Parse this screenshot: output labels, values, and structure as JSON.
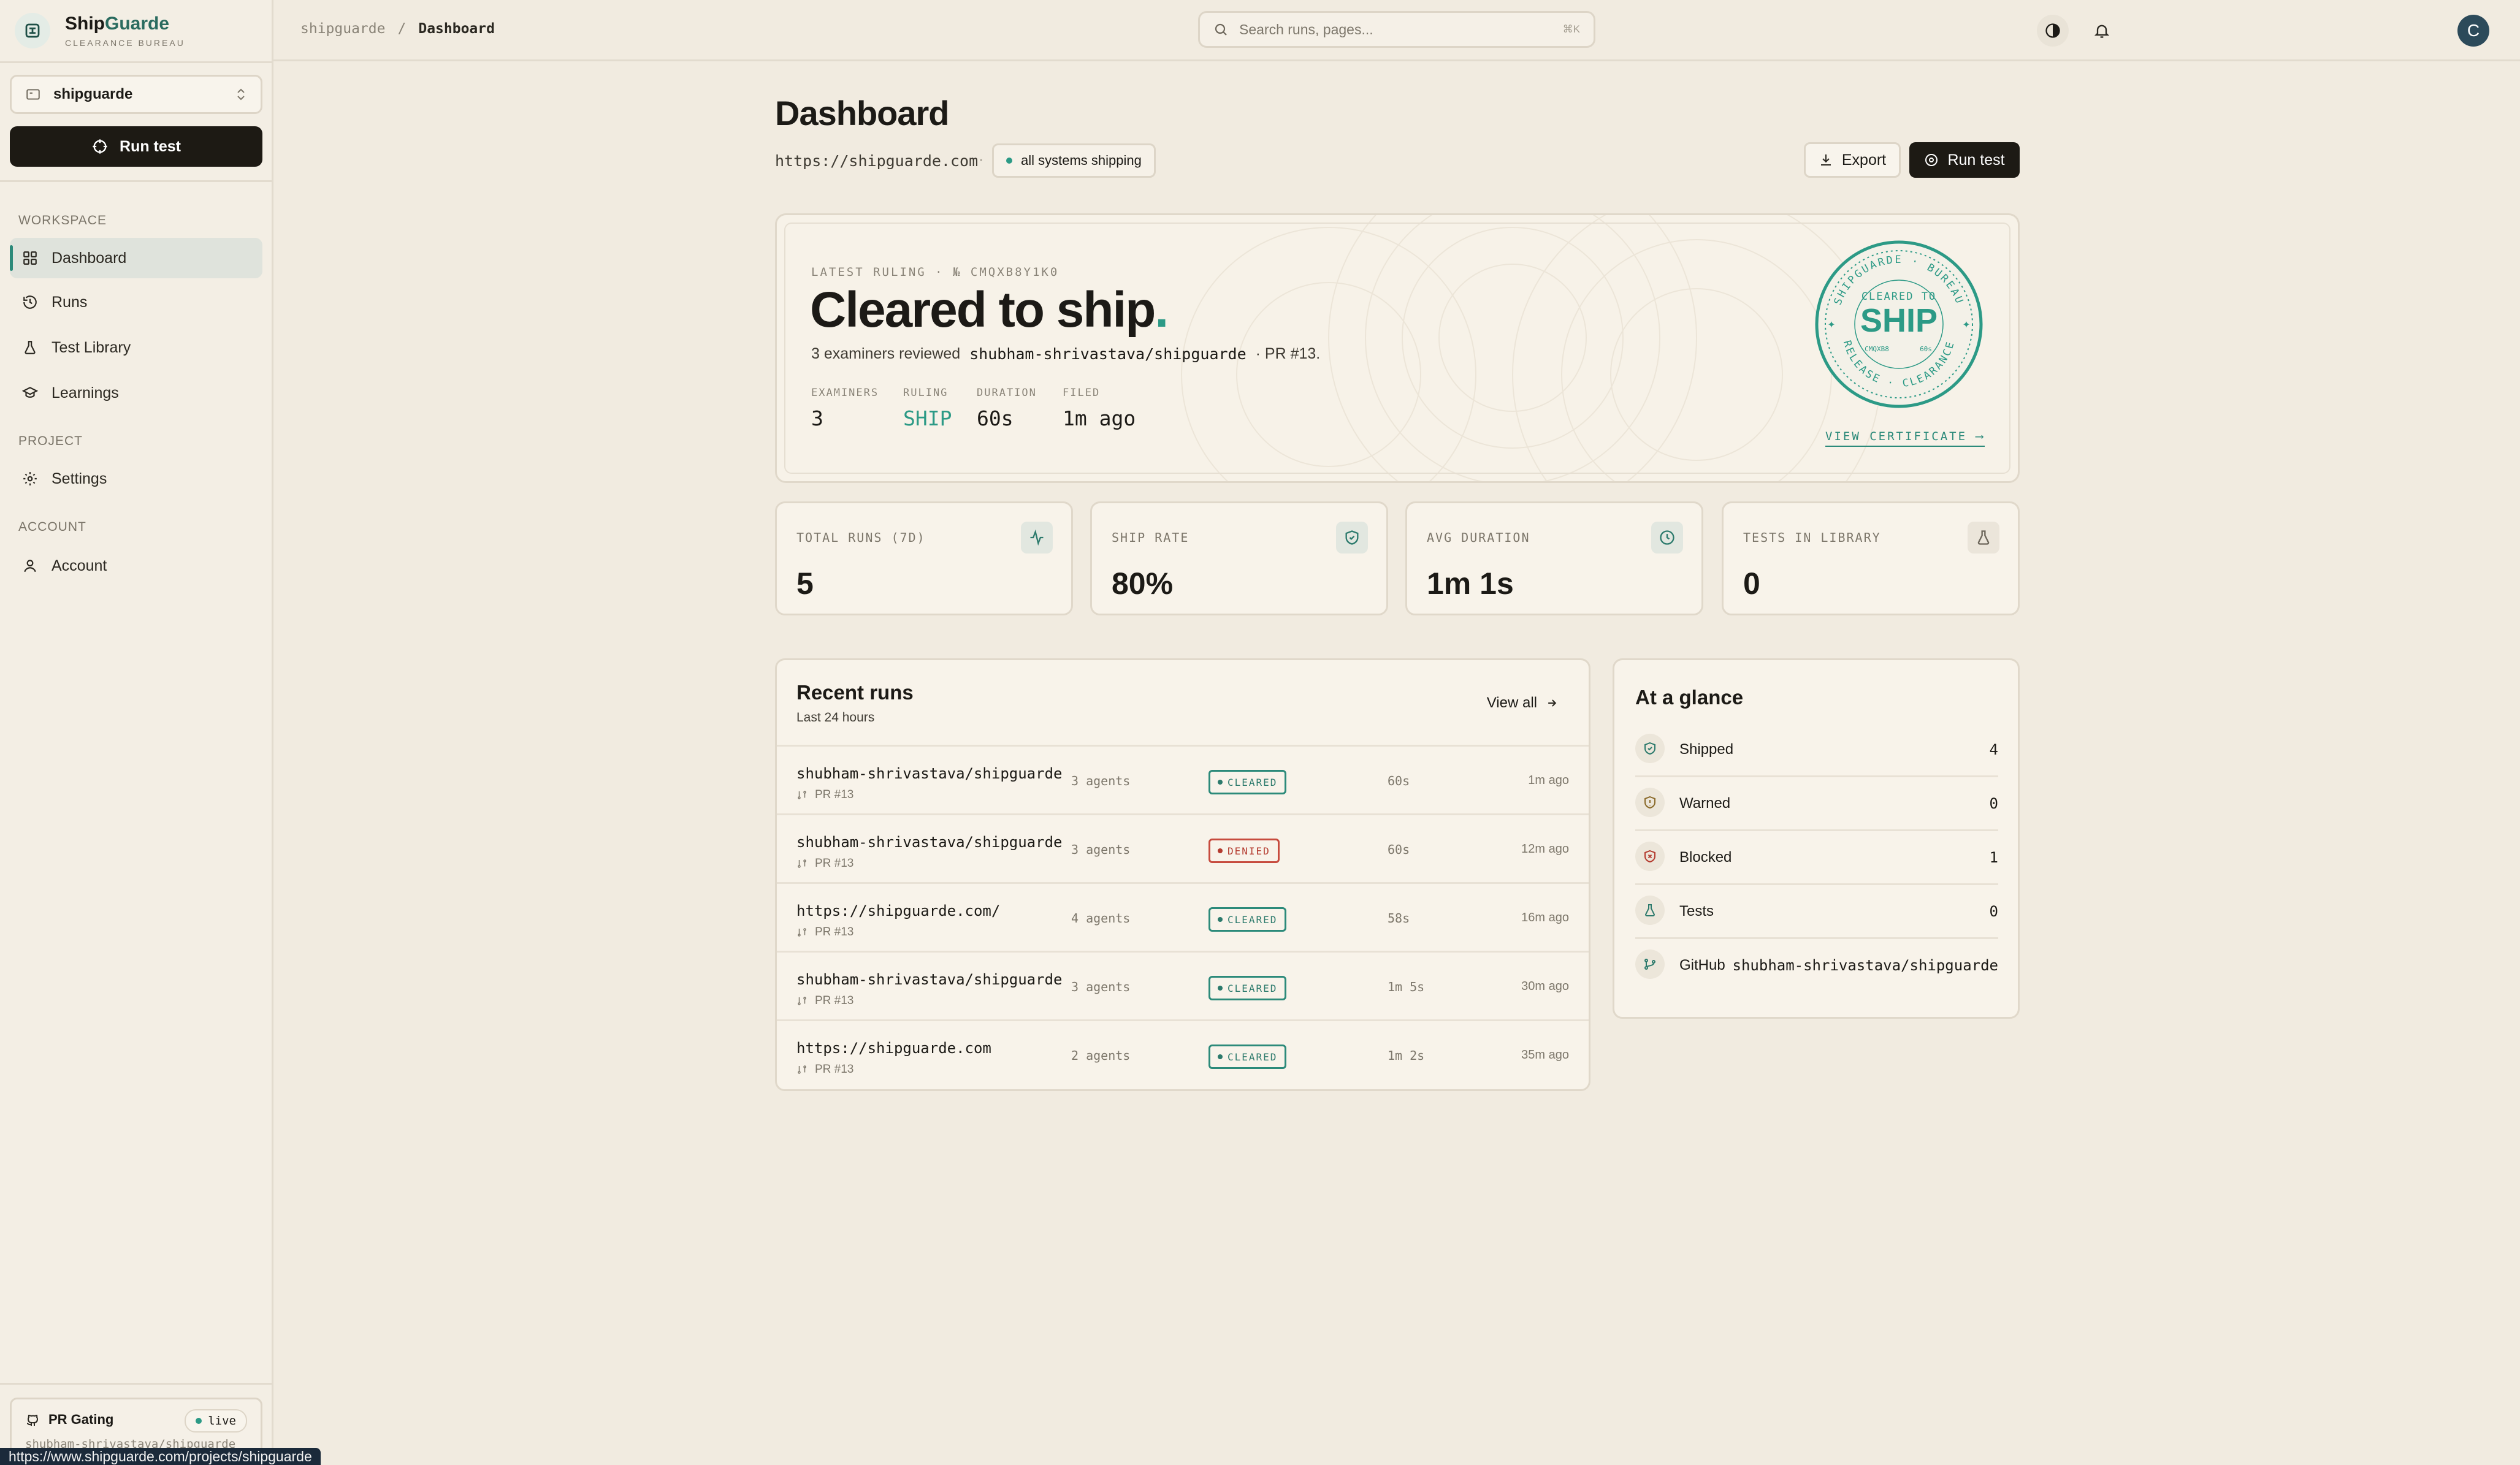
{
  "brand": {
    "name_a": "Ship",
    "name_b": "Guarde",
    "subtitle": "CLEARANCE BUREAU"
  },
  "sidebar": {
    "project": "shipguarde",
    "run_test": "Run test",
    "workspace_label": "WORKSPACE",
    "project_label": "PROJECT",
    "account_label": "ACCOUNT",
    "items": [
      {
        "label": "Dashboard",
        "icon": "grid-icon",
        "active": true
      },
      {
        "label": "Runs",
        "icon": "history-icon"
      },
      {
        "label": "Test Library",
        "icon": "flask-icon"
      },
      {
        "label": "Learnings",
        "icon": "graduation-cap-icon"
      }
    ],
    "settings": "Settings",
    "account": "Account",
    "pr_gating": {
      "title": "PR Gating",
      "status": "live",
      "repo": "shubham-shrivastava/shipguarde"
    }
  },
  "status_url": "https://www.shipguarde.com/projects/shipguarde",
  "topbar": {
    "breadcrumb": [
      "shipguarde",
      "/",
      "Dashboard"
    ],
    "search_placeholder": "Search runs, pages...",
    "search_shortcut": "⌘K",
    "avatar": "C"
  },
  "header": {
    "title": "Dashboard",
    "url": "https://shipguarde.com",
    "separator": "·",
    "status": "all systems shipping",
    "export": "Export",
    "run_test": "Run test"
  },
  "ruling": {
    "eyebrow": "LATEST RULING · № CMQXB8Y1K0",
    "headline": "Cleared to ship",
    "period": ".",
    "desc_pre": "3 examiners reviewed ",
    "desc_repo": "shubham-shrivastava/shipguarde",
    "desc_post": " · PR #13.",
    "stats": [
      {
        "label": "EXAMINERS",
        "value": "3"
      },
      {
        "label": "RULING",
        "value": "SHIP"
      },
      {
        "label": "DURATION",
        "value": "60s"
      },
      {
        "label": "FILED",
        "value": "1m ago"
      }
    ],
    "seal": {
      "top": "SHIPGUARDE · BUREAU",
      "mid": "CLEARED TO",
      "big": "SHIP",
      "small_left": "CMQXB8",
      "small_right": "60s",
      "bottom": "RELEASE · CLEARANCE"
    },
    "view_certificate": "VIEW CERTIFICATE ⟶"
  },
  "stats": [
    {
      "label": "TOTAL RUNS (7D)",
      "value": "5",
      "icon": "activity-icon"
    },
    {
      "label": "SHIP RATE",
      "value": "80%",
      "icon": "shield-check-icon"
    },
    {
      "label": "AVG DURATION",
      "value": "1m 1s",
      "icon": "clock-icon"
    },
    {
      "label": "TESTS IN LIBRARY",
      "value": "0",
      "icon": "flask-icon"
    }
  ],
  "recent_runs": {
    "title": "Recent runs",
    "subtitle": "Last 24 hours",
    "view_all": "View all",
    "rows": [
      {
        "repo": "shubham-shrivastava/shipguarde",
        "pr": "PR #13",
        "agents": "3 agents",
        "status": "CLEARED",
        "duration": "60s",
        "ago": "1m ago"
      },
      {
        "repo": "shubham-shrivastava/shipguarde",
        "pr": "PR #13",
        "agents": "3 agents",
        "status": "DENIED",
        "duration": "60s",
        "ago": "12m ago"
      },
      {
        "repo": "https://shipguarde.com/",
        "pr": "PR #13",
        "agents": "4 agents",
        "status": "CLEARED",
        "duration": "58s",
        "ago": "16m ago"
      },
      {
        "repo": "shubham-shrivastava/shipguarde",
        "pr": "PR #13",
        "agents": "3 agents",
        "status": "CLEARED",
        "duration": "1m 5s",
        "ago": "30m ago"
      },
      {
        "repo": "https://shipguarde.com",
        "pr": "PR #13",
        "agents": "2 agents",
        "status": "CLEARED",
        "duration": "1m 2s",
        "ago": "35m ago"
      }
    ]
  },
  "glance": {
    "title": "At a glance",
    "rows": [
      {
        "label": "Shipped",
        "value": "4",
        "icon": "shield-check-icon"
      },
      {
        "label": "Warned",
        "value": "0",
        "icon": "shield-alert-icon"
      },
      {
        "label": "Blocked",
        "value": "1",
        "icon": "shield-x-icon"
      },
      {
        "label": "Tests",
        "value": "0",
        "icon": "flask-icon"
      },
      {
        "label": "GitHub",
        "value": "shubham-shrivastava/shipguarde",
        "icon": "git-branch-icon"
      }
    ]
  },
  "colors": {
    "accent": "#2c9a86",
    "dark": "#1d1a14",
    "background": "#f1ebe0",
    "denied": "#c74b3e"
  }
}
